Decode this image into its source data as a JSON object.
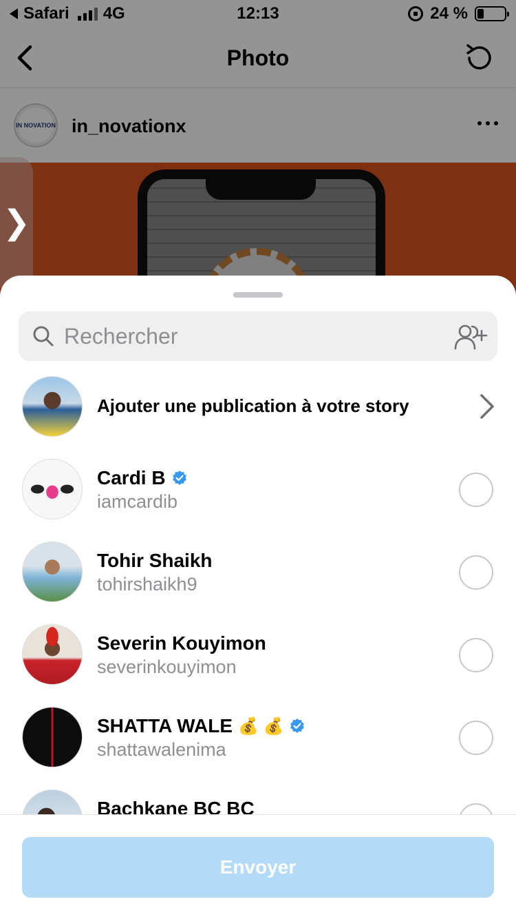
{
  "status_bar": {
    "carrier": "Safari",
    "network": "4G",
    "time": "12:13",
    "battery_percent_label": "24 %",
    "battery_level": 0.24
  },
  "nav": {
    "title": "Photo"
  },
  "post": {
    "username": "in_novationx",
    "avatar_text": "IN NOVATION"
  },
  "side_tab": {
    "glyph": "❯"
  },
  "share_sheet": {
    "search": {
      "placeholder": "Rechercher",
      "value": ""
    },
    "story": {
      "label": "Ajouter une publication à votre story"
    },
    "contacts": [
      {
        "name": "Cardi B",
        "handle": "iamcardib",
        "verified": true
      },
      {
        "name": "Tohir Shaikh",
        "handle": "tohirshaikh9",
        "verified": false
      },
      {
        "name": "Severin Kouyimon",
        "handle": "severinkouyimon",
        "verified": false
      },
      {
        "name": "SHATTA WALE",
        "handle": "shattawalenima",
        "verified": true,
        "emoji": "💰 💰"
      },
      {
        "name": "Bachkane BC BC",
        "handle": "",
        "verified": false
      }
    ],
    "send_label": "Envoyer"
  },
  "colors": {
    "send_disabled": "#b3dbf7",
    "verified_blue": "#3897f0",
    "post_bg": "#d9541e"
  }
}
